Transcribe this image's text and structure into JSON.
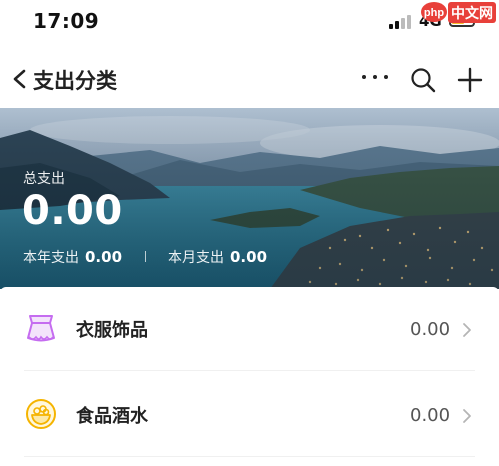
{
  "status_bar": {
    "time": "17:09",
    "network": "4G",
    "watermark": "php中文网"
  },
  "nav": {
    "title": "支出分类",
    "back_icon": "chevron-left-icon",
    "more_icon": "more-horizontal-icon",
    "search_icon": "search-icon",
    "add_icon": "plus-icon"
  },
  "hero": {
    "total_label": "总支出",
    "total_value": "0.00",
    "year_label": "本年支出",
    "year_value": "0.00",
    "month_label": "本月支出",
    "month_value": "0.00"
  },
  "categories": [
    {
      "label": "衣服饰品",
      "amount": "0.00",
      "icon": "clothing-icon",
      "icon_color": "#c56cf0"
    },
    {
      "label": "食品酒水",
      "amount": "0.00",
      "icon": "food-bowl-icon",
      "icon_color": "#f5b400"
    }
  ]
}
